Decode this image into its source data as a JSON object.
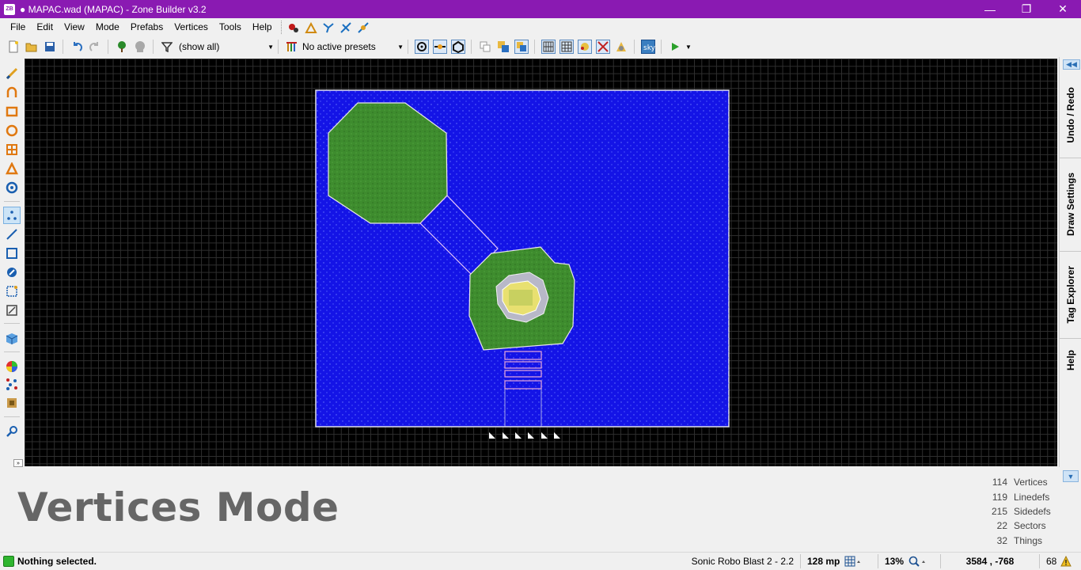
{
  "window": {
    "title": "● MAPAC.wad (MAPAC) - Zone Builder v3.2",
    "app_icon": "ZB",
    "minimize": "—",
    "restore": "❐",
    "close": "✕"
  },
  "menu": {
    "items": [
      "File",
      "Edit",
      "View",
      "Mode",
      "Prefabs",
      "Vertices",
      "Tools",
      "Help"
    ]
  },
  "toolbar": {
    "filter_label": "(show all)",
    "presets_label": "No active presets"
  },
  "dock": {
    "tabs": [
      "Undo / Redo",
      "Draw Settings",
      "Tag Explorer",
      "Help"
    ]
  },
  "info": {
    "mode_title": "Vertices Mode",
    "stats": [
      {
        "count": "114",
        "label": "Vertices"
      },
      {
        "count": "119",
        "label": "Linedefs"
      },
      {
        "count": "215",
        "label": "Sidedefs"
      },
      {
        "count": "22",
        "label": "Sectors"
      },
      {
        "count": "32",
        "label": "Things"
      }
    ]
  },
  "status": {
    "message": "Nothing selected.",
    "game": "Sonic Robo Blast 2 - 2.2",
    "grid": "128 mp",
    "zoom": "13%",
    "coords": "3584 , -768",
    "warnings": "68",
    "led_color": "#2fb52f"
  },
  "colors": {
    "title_bar": "#8a1ab2",
    "map_background": "#000000",
    "water_sector": "#1414e6",
    "grass_sector": "#3e8c2e",
    "center_yellow": "#e8e070"
  }
}
